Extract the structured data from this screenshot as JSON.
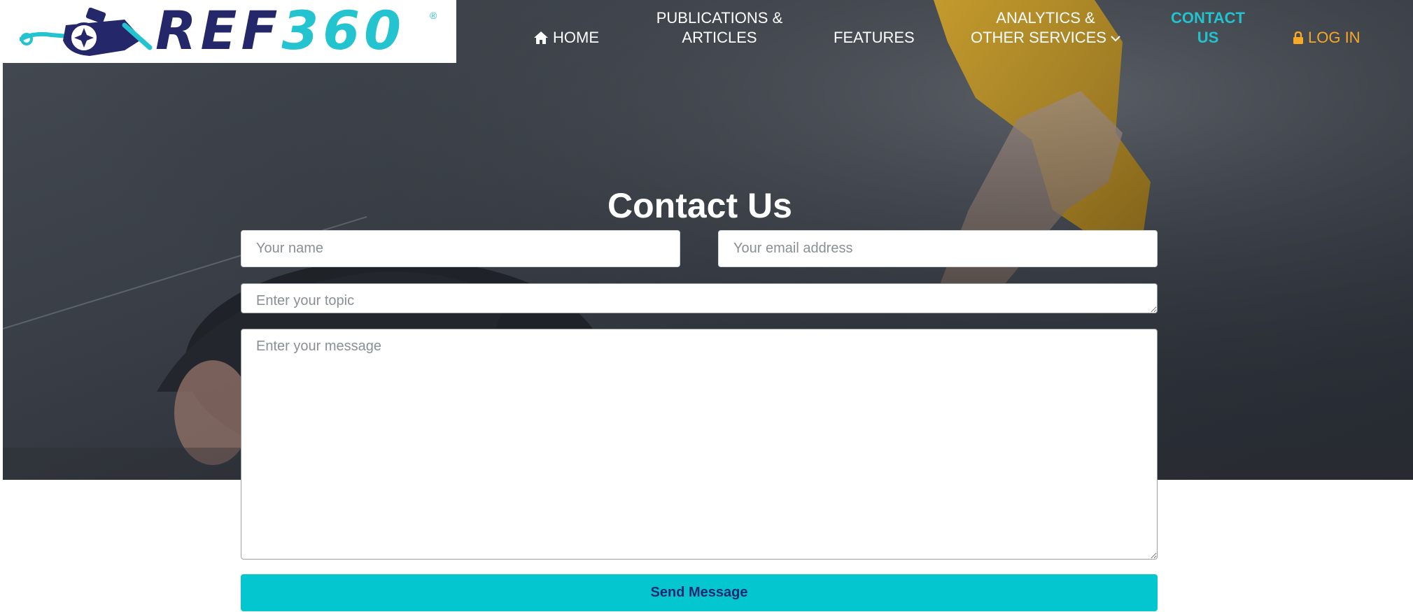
{
  "brand": {
    "name_part1": "REF",
    "name_part2": "360",
    "registered": "®",
    "colors": {
      "navy": "#24276a",
      "teal": "#23c4d0"
    }
  },
  "nav": {
    "home": {
      "icon": "home-icon",
      "label": "HOME"
    },
    "publications": {
      "line1": "PUBLICATIONS &",
      "line2": "ARTICLES"
    },
    "features": {
      "label": "FEATURES"
    },
    "analytics": {
      "line1": "ANALYTICS &",
      "line2": "OTHER SERVICES",
      "icon": "chevron-down-icon"
    },
    "contact": {
      "line1": "CONTACT",
      "line2": "US",
      "active": true,
      "color": "#22c3cf"
    },
    "login": {
      "icon": "lock-icon",
      "label": "LOG IN",
      "color": "#f6a826"
    }
  },
  "form": {
    "title": "Contact Us",
    "name": {
      "placeholder": "Your name",
      "value": ""
    },
    "email": {
      "placeholder": "Your email address",
      "value": ""
    },
    "topic": {
      "placeholder": "Enter your topic",
      "value": ""
    },
    "message": {
      "placeholder": "Enter your message",
      "value": ""
    },
    "submit_label": "Send Message",
    "submit_color": "#03c6cf"
  }
}
